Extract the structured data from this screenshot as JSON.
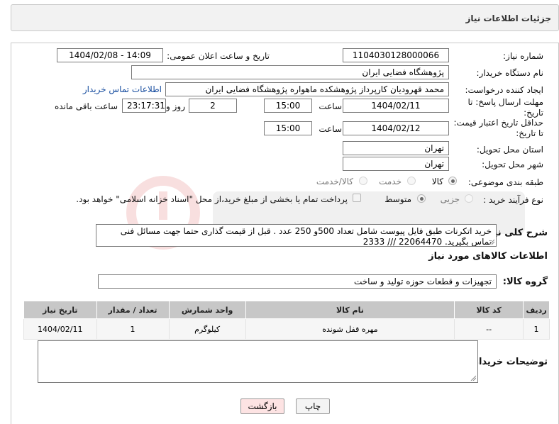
{
  "header": {
    "title": "جزئیات اطلاعات نیاز"
  },
  "form": {
    "need_number": {
      "label": "شماره نیاز:",
      "value": "1104030128000066"
    },
    "announce": {
      "label": "تاریخ و ساعت اعلان عمومی:",
      "value": "1404/02/08 - 14:09"
    },
    "buyer_org": {
      "label": "نام دستگاه خریدار:",
      "value": "پژوهشگاه فضایی ایران"
    },
    "creator": {
      "label": "ایجاد کننده درخواست:",
      "value": "محمد قهرودیان کارپرداز پژوهشکده ماهواره پژوهشگاه فضایی ایران",
      "contact_link": "اطلاعات تماس خریدار"
    },
    "reply_deadline": {
      "label": "مهلت ارسال پاسخ: تا تاریخ:",
      "date": "1404/02/11",
      "time_label": "ساعت",
      "time": "15:00",
      "days": "2",
      "days_label": "روز و",
      "remaining": "23:17:31",
      "remaining_label": "ساعت باقی مانده"
    },
    "price_validity": {
      "label": "حداقل تاریخ اعتبار قیمت: تا تاریخ:",
      "date": "1404/02/12",
      "time_label": "ساعت",
      "time": "15:00"
    },
    "province": {
      "label": "استان محل تحویل:",
      "value": "تهران"
    },
    "city": {
      "label": "شهر محل تحویل:",
      "value": "تهران"
    },
    "category": {
      "label": "طبقه بندی موضوعی:",
      "options": [
        "کالا",
        "خدمت",
        "کالا/خدمت"
      ]
    },
    "process": {
      "label": "نوع فرآیند خرید :",
      "options": [
        "جزیی",
        "متوسط"
      ],
      "payment_note": "پرداخت تمام یا بخشی از مبلغ خرید،از محل \"اسناد خزانه اسلامی\" خواهد بود."
    },
    "description": {
      "label": "شرح کلی نیاز:",
      "line1": "خرید اتکرنات طبق فایل پیوست شامل تعداد 500و 250 عدد . قبل از قیمت گذاری حتما جهت مسائل فنی",
      "line2": "تماس بگیرید. 22064470 /// 2333"
    }
  },
  "goods": {
    "section_title": "اطلاعات کالاهای مورد نیاز",
    "group_label": "گروه کالا:",
    "group_value": "تجهیزات و قطعات حوزه تولید و ساخت",
    "columns": [
      "ردیف",
      "کد کالا",
      "نام کالا",
      "واحد شمارش",
      "تعداد / مقدار",
      "تاریخ نیاز"
    ],
    "rows": [
      {
        "row": "1",
        "code": "--",
        "name": "مهره قفل شونده",
        "unit": "کیلوگرم",
        "qty": "1",
        "date": "1404/02/11"
      }
    ]
  },
  "buyer_notes": {
    "label": "توضیحات خریدار:",
    "value": ""
  },
  "buttons": {
    "print": "چاپ",
    "back": "بازگشت"
  },
  "colors": {
    "back_button_bg": "#fde3e3",
    "header_bg": "#f2f2f2",
    "table_header_bg": "#c7c7c7",
    "link": "#1a4fa0"
  }
}
